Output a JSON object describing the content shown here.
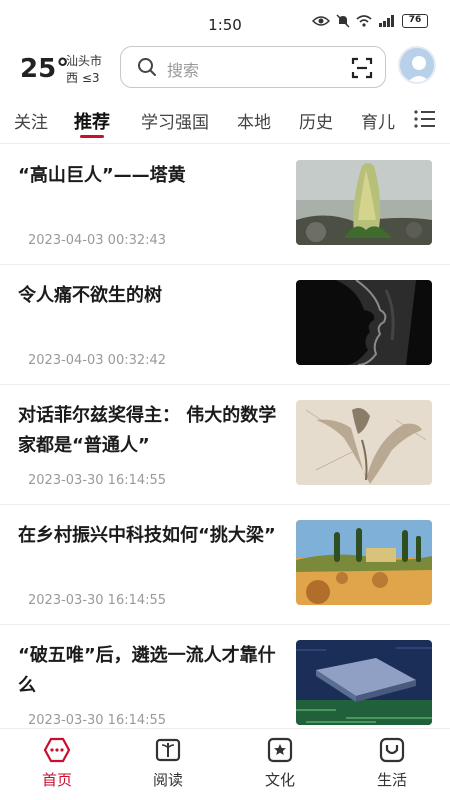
{
  "status": {
    "time": "1:50",
    "battery": "76"
  },
  "weather": {
    "temperature": "25°",
    "city": "汕头市",
    "wind": "西  ≤3"
  },
  "search": {
    "placeholder": "搜索"
  },
  "tabs": [
    {
      "label": "关注"
    },
    {
      "label": "推荐",
      "active": true
    },
    {
      "label": "学习强国"
    },
    {
      "label": "本地"
    },
    {
      "label": "历史"
    },
    {
      "label": "育儿"
    }
  ],
  "feed": [
    {
      "title": "“高山巨人”——塔黄",
      "date": "2023-04-03 00:32:43"
    },
    {
      "title": "令人痛不欲生的树",
      "date": "2023-04-03 00:32:42"
    },
    {
      "title": "对话菲尔兹奖得主： 伟大的数学家都是“普通人”",
      "date": "2023-03-30 16:14:55"
    },
    {
      "title": "在乡村振兴中科技如何“挑大梁”",
      "date": "2023-03-30 16:14:55"
    },
    {
      "title": "“破五唯”后，遴选一流人才靠什么",
      "date": "2023-03-30 16:14:55"
    }
  ],
  "bottom_nav": [
    {
      "label": "首页",
      "active": true
    },
    {
      "label": "阅读"
    },
    {
      "label": "文化"
    },
    {
      "label": "生活"
    }
  ],
  "colors": {
    "accent": "#c8102e"
  }
}
